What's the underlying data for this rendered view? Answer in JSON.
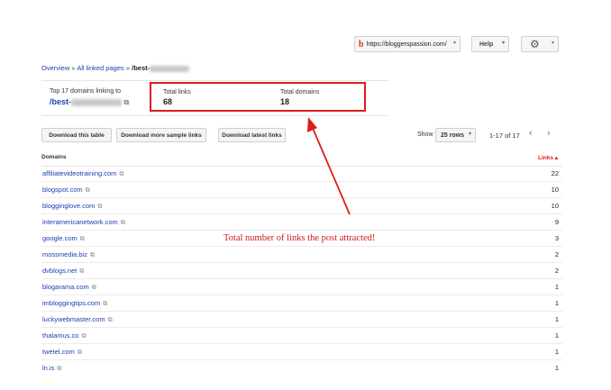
{
  "header": {
    "site_selector": {
      "icon": "b-logo-icon",
      "label": "https://bloggerspassion.com/"
    },
    "help_label": "Help",
    "settings_icon": "gear-icon"
  },
  "breadcrumb": {
    "overview": "Overview",
    "separator": "»",
    "all_linked_pages": "All linked pages",
    "current": "/best-"
  },
  "summary": {
    "top_domains_label": "Top 17 domains linking to",
    "top_domains_link": "/best-",
    "total_links_label": "Total links",
    "total_links_value": "68",
    "total_domains_label": "Total domains",
    "total_domains_value": "18"
  },
  "toolbar": {
    "download_table": "Download this table",
    "download_more": "Download more sample links",
    "download_latest": "Download latest links",
    "show_label": "Show",
    "rows_option": "25 rows",
    "pager_text": "1-17 of 17"
  },
  "table": {
    "col_domains": "Domains",
    "col_links": "Links ▴",
    "rows": [
      {
        "domain": "affiliatevideotraining.com",
        "links": "22"
      },
      {
        "domain": "blogspot.com",
        "links": "10"
      },
      {
        "domain": "blogginglove.com",
        "links": "10"
      },
      {
        "domain": "interamericanetwork.com",
        "links": "9"
      },
      {
        "domain": "google.com",
        "links": "3"
      },
      {
        "domain": "mossmedia.biz",
        "links": "2"
      },
      {
        "domain": "dvblogs.net",
        "links": "2"
      },
      {
        "domain": "blogarama.com",
        "links": "1"
      },
      {
        "domain": "imbloggingtips.com",
        "links": "1"
      },
      {
        "domain": "luckywebmaster.com",
        "links": "1"
      },
      {
        "domain": "thalamus.co",
        "links": "1"
      },
      {
        "domain": "twetel.com",
        "links": "1"
      },
      {
        "domain": "ln.is",
        "links": "1"
      }
    ]
  },
  "annotation": {
    "text": "Total number of links the post attracted!",
    "color": "#dd1c1c"
  }
}
